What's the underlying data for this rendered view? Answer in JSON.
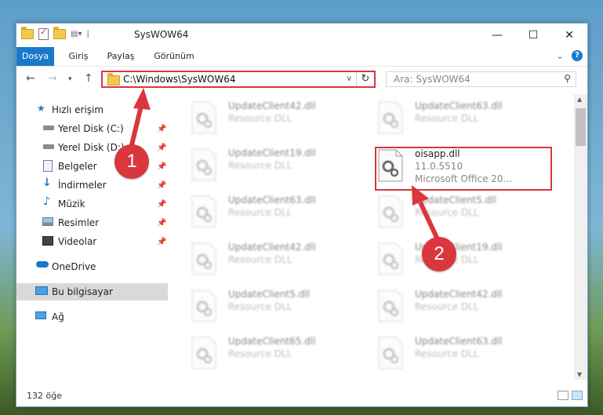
{
  "window": {
    "title": "SysWOW64",
    "controls": {
      "minimize": "—",
      "maximize": "☐",
      "close": "✕"
    }
  },
  "ribbon": {
    "tabs": [
      "Dosya",
      "Giriş",
      "Paylaş",
      "Görünüm"
    ],
    "active_tab": "Dosya",
    "expand_icon": "⌄",
    "help_label": "?"
  },
  "address": {
    "path": "C:\\Windows\\SysWOW64",
    "search_placeholder": "Ara: SysWOW64"
  },
  "sidebar": {
    "items": [
      {
        "label": "Hızlı erişim",
        "icon": "star-icon",
        "pinned": false
      },
      {
        "label": "Yerel Disk (C:)",
        "icon": "drive-icon",
        "pinned": true
      },
      {
        "label": "Yerel Disk (D:)",
        "icon": "drive-icon",
        "pinned": true
      },
      {
        "label": "Belgeler",
        "icon": "documents-icon",
        "pinned": true
      },
      {
        "label": "İndirmeler",
        "icon": "download-icon",
        "pinned": true
      },
      {
        "label": "Müzik",
        "icon": "music-icon",
        "pinned": true
      },
      {
        "label": "Resimler",
        "icon": "pictures-icon",
        "pinned": true
      },
      {
        "label": "Videolar",
        "icon": "videos-icon",
        "pinned": true
      },
      {
        "label": "OneDrive",
        "icon": "cloud-icon",
        "pinned": false
      },
      {
        "label": "Bu bilgisayar",
        "icon": "computer-icon",
        "pinned": false,
        "selected": true
      },
      {
        "label": "Ağ",
        "icon": "network-icon",
        "pinned": false
      }
    ]
  },
  "files": [
    {
      "name": "UpdateClient42.dll",
      "desc": "Resource DLL"
    },
    {
      "name": "UpdateClient63.dll",
      "desc": "Resource DLL"
    },
    {
      "name": "UpdateClient19.dll",
      "desc": "Resource DLL"
    },
    {
      "name": "oisapp.dll",
      "version": "11.0.5510",
      "company": "Microsoft Office 20...",
      "highlighted": true
    },
    {
      "name": "UpdateClient63.dll",
      "desc": "Resource DLL"
    },
    {
      "name": "UpdateClient5.dll",
      "desc": "Resource DLL"
    },
    {
      "name": "UpdateClient42.dll",
      "desc": "Resource DLL"
    },
    {
      "name": "UpdateClient19.dll",
      "desc": "Resource DLL"
    },
    {
      "name": "UpdateClient5.dll",
      "desc": "Resource DLL"
    },
    {
      "name": "UpdateClient42.dll",
      "desc": "Resource DLL"
    },
    {
      "name": "UpdateClient65.dll",
      "desc": "Resource DLL"
    },
    {
      "name": "UpdateClient63.dll",
      "desc": "Resource DLL"
    }
  ],
  "status": {
    "count": "132 öğe"
  },
  "annotations": {
    "step1": "1",
    "step2": "2",
    "color": "#d9363e"
  },
  "colors": {
    "accent": "#1979ca",
    "highlight": "#d9363e"
  }
}
